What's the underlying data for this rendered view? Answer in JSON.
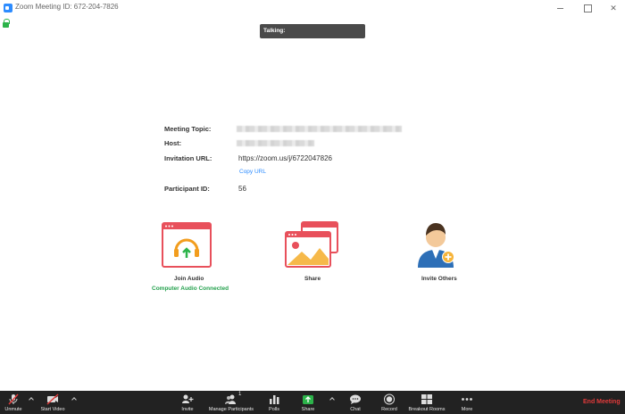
{
  "window": {
    "title": "Zoom Meeting ID: 672-204-7826"
  },
  "talking": "Talking:",
  "info": {
    "topic_label": "Meeting Topic:",
    "host_label": "Host:",
    "url_label": "Invitation URL:",
    "url_value": "https://zoom.us/j/6722047826",
    "copy_url": "Copy URL",
    "participant_label": "Participant ID:",
    "participant_value": "56"
  },
  "actions": {
    "join_audio": "Join Audio",
    "audio_status": "Computer Audio Connected",
    "share": "Share",
    "invite_others": "Invite Others"
  },
  "toolbar": {
    "unmute": "Unmute",
    "start_video": "Start Video",
    "invite": "Invite",
    "manage_participants": "Manage Participants",
    "participant_count": "1",
    "polls": "Polls",
    "share": "Share",
    "chat": "Chat",
    "record": "Record",
    "breakout_rooms": "Breakout Rooms",
    "more": "More",
    "end_meeting": "End Meeting"
  },
  "colors": {
    "accent_blue": "#2d8cff",
    "share_green": "#2cb34a",
    "end_red": "#e23a3a",
    "tile_red": "#e8505b",
    "status_green": "#23a04c"
  }
}
